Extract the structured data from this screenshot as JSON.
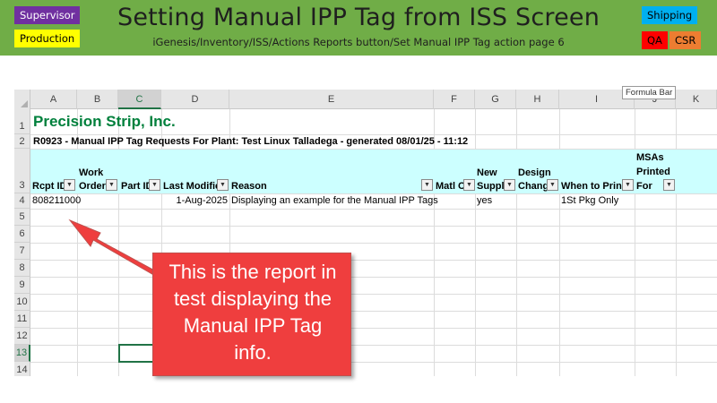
{
  "header": {
    "title": "Setting Manual IPP Tag from ISS Screen",
    "subtitle": "iGenesis/Inventory/ISS/Actions Reports button/Set Manual IPP Tag action page 6",
    "tags": {
      "supervisor": "Supervisor",
      "production": "Production",
      "shipping": "Shipping",
      "qa": "QA",
      "csr": "CSR"
    },
    "colors": {
      "banner": "#70ad47"
    }
  },
  "tooltip": {
    "formula_bar": "Formula Bar"
  },
  "sheet": {
    "columns": [
      "A",
      "B",
      "C",
      "D",
      "E",
      "F",
      "G",
      "H",
      "I",
      "J",
      "K"
    ],
    "selected_column": "C",
    "rows": [
      "1",
      "2",
      "3",
      "4",
      "5",
      "6",
      "7",
      "8",
      "9",
      "10",
      "11",
      "12",
      "13",
      "14"
    ],
    "selected_row": "13",
    "company": "Precision Strip, Inc.",
    "report_title": "R0923 - Manual IPP Tag Requests For Plant: Test Linux Talladega - generated 08/01/25 - 11:12",
    "table_headers": {
      "rcpt_id": "Rcpt ID",
      "work_order_1": "Work",
      "work_order_2": "Order",
      "part_id": "Part ID",
      "last_modified": "Last Modified",
      "reason": "Reason",
      "matl_ch": "Matl Ch",
      "new_supplier_1": "New",
      "new_supplier_2": "Supplie",
      "design_change_1": "Design",
      "design_change_2": "Change",
      "when_to_print": "When to Print",
      "msas_1": "MSAs",
      "msas_2": "Printed",
      "msas_3": "For"
    },
    "data_row": {
      "rcpt_id": "808211000",
      "work_order": "",
      "part_id": "",
      "last_modified": "1-Aug-2025",
      "reason": "Displaying an example for the Manual IPP Tags",
      "matl_ch": "",
      "new_supplier": "yes",
      "design_change": "",
      "when_to_print": "1St Pkg Only",
      "msas_printed_for": ""
    }
  },
  "callout": {
    "line1": "This is the report in",
    "line2": "test displaying the",
    "line3": "Manual IPP Tag",
    "line4": "info.",
    "color": "#ef3e3e"
  }
}
